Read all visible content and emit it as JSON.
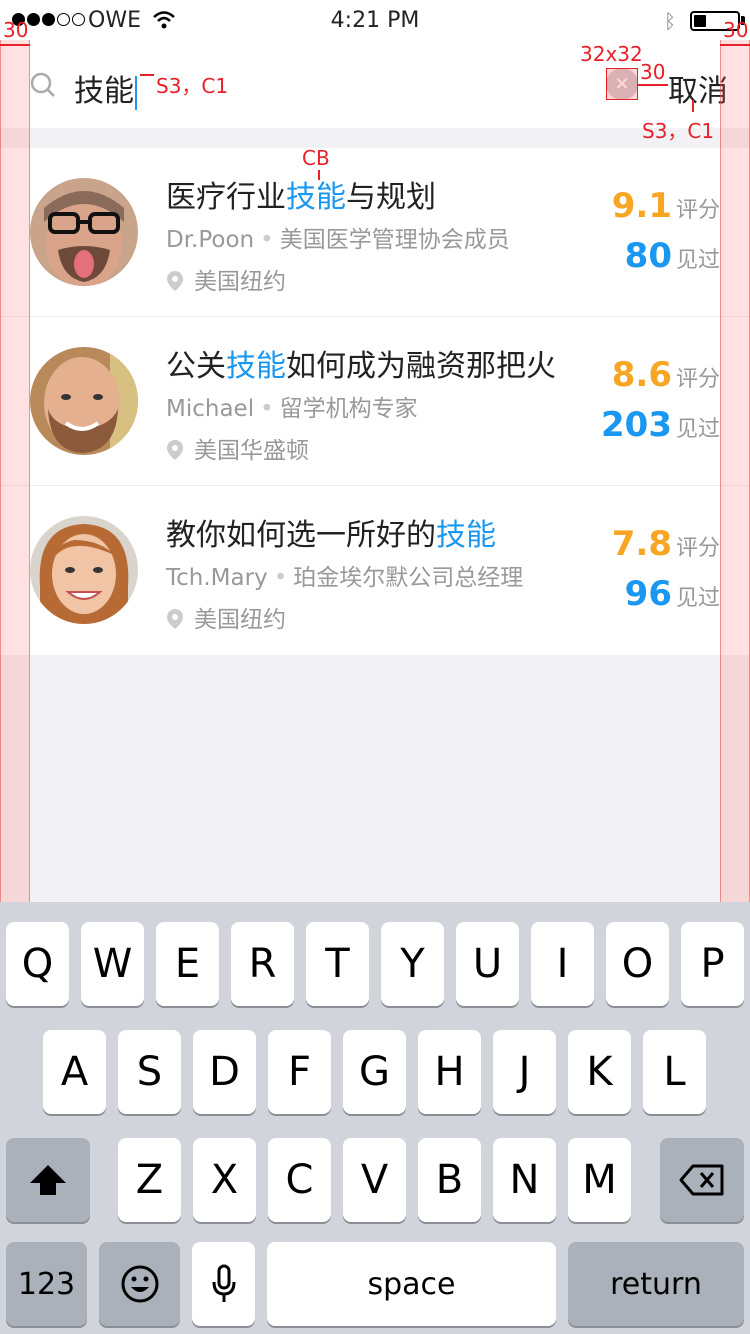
{
  "status_bar": {
    "carrier": "OWE",
    "time": "4:21 PM"
  },
  "search": {
    "query": "技能",
    "clear_icon": "clear-icon",
    "cancel_label": "取消"
  },
  "annotations": {
    "left_margin": "30",
    "right_margin": "30",
    "clear_size": "32x32",
    "clear_gap": "30",
    "search_style": "S3，C1",
    "cancel_style": "S3，C1",
    "highlight_style": "CB"
  },
  "results": [
    {
      "title_before": "医疗行业",
      "title_highlight": "技能",
      "title_after": "与规划",
      "name": "Dr.Poon",
      "role": "美国医学管理协会成员",
      "location": "美国纽约",
      "score": "9.1",
      "score_unit": "评分",
      "seen": "80",
      "seen_unit": "见过"
    },
    {
      "title_before": "公关",
      "title_highlight": "技能",
      "title_after": "如何成为融资那把火",
      "name": "Michael",
      "role": "留学机构专家",
      "location": "美国华盛顿",
      "score": "8.6",
      "score_unit": "评分",
      "seen": "203",
      "seen_unit": "见过"
    },
    {
      "title_before": "教你如何选一所好的",
      "title_highlight": "技能",
      "title_after": "",
      "name": "Tch.Mary",
      "role": "珀金埃尔默公司总经理",
      "location": "美国纽约",
      "score": "7.8",
      "score_unit": "评分",
      "seen": "96",
      "seen_unit": "见过"
    }
  ],
  "keyboard": {
    "row1": [
      "Q",
      "W",
      "E",
      "R",
      "T",
      "Y",
      "U",
      "I",
      "O",
      "P"
    ],
    "row2": [
      "A",
      "S",
      "D",
      "F",
      "G",
      "H",
      "J",
      "K",
      "L"
    ],
    "row3": [
      "Z",
      "X",
      "C",
      "V",
      "B",
      "N",
      "M"
    ],
    "numbers": "123",
    "space": "space",
    "return": "return"
  },
  "colors": {
    "accent": "#1a97f0",
    "score": "#f6a623",
    "annotation": "#e8202a"
  }
}
